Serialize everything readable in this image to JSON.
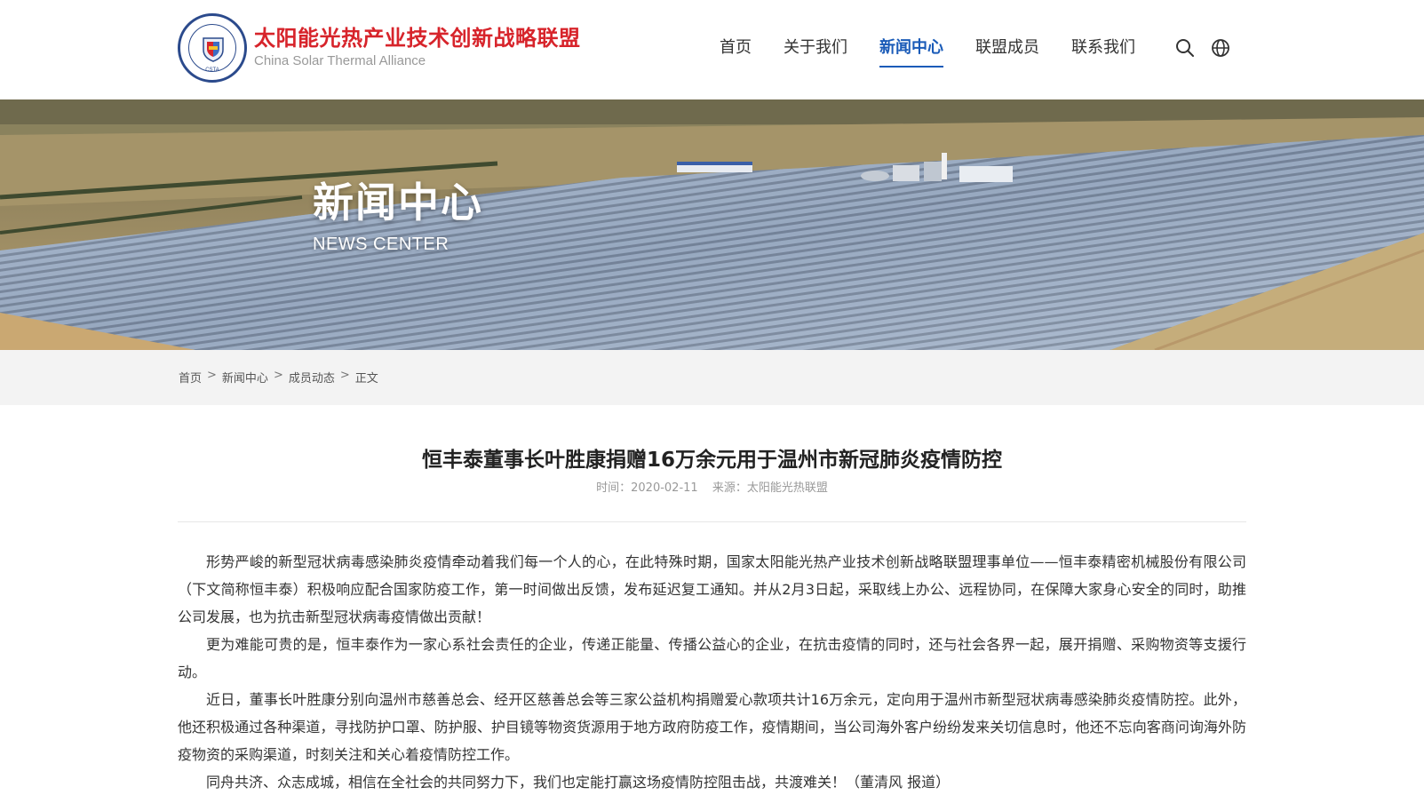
{
  "header": {
    "logo_cn": "太阳能光热产业技术创新战略联盟",
    "logo_en": "China Solar Thermal Alliance",
    "logo_badge": "CSTA",
    "nav": [
      {
        "label": "首页",
        "active": false
      },
      {
        "label": "关于我们",
        "active": false
      },
      {
        "label": "新闻中心",
        "active": true
      },
      {
        "label": "联盟成员",
        "active": false
      },
      {
        "label": "联系我们",
        "active": false
      }
    ],
    "icons": [
      "search-icon",
      "globe-icon"
    ]
  },
  "banner": {
    "title": "新闻中心",
    "subtitle": "NEWS CENTER"
  },
  "breadcrumb": {
    "items": [
      "首页",
      "新闻中心",
      "成员动态",
      "正文"
    ],
    "separator": ">"
  },
  "article": {
    "title": "恒丰泰董事长叶胜康捐赠16万余元用于温州市新冠肺炎疫情防控",
    "time_label": "时间：2020-02-11",
    "source_label": "来源：太阳能光热联盟",
    "paragraphs": [
      "形势严峻的新型冠状病毒感染肺炎疫情牵动着我们每一个人的心，在此特殊时期，国家太阳能光热产业技术创新战略联盟理事单位——恒丰泰精密机械股份有限公司（下文简称恒丰泰）积极响应配合国家防疫工作，第一时间做出反馈，发布延迟复工通知。并从2月3日起，采取线上办公、远程协同，在保障大家身心安全的同时，助推公司发展，也为抗击新型冠状病毒疫情做出贡献！",
      "更为难能可贵的是，恒丰泰作为一家心系社会责任的企业，传递正能量、传播公益心的企业，在抗击疫情的同时，还与社会各界一起，展开捐赠、采购物资等支援行动。",
      "近日，董事长叶胜康分别向温州市慈善总会、经开区慈善总会等三家公益机构捐赠爱心款项共计16万余元，定向用于温州市新型冠状病毒感染肺炎疫情防控。此外，他还积极通过各种渠道，寻找防护口罩、防护服、护目镜等物资货源用于地方政府防疫工作，疫情期间，当公司海外客户纷纷发来关切信息时，他还不忘向客商问询海外防疫物资的采购渠道，时刻关注和关心着疫情防控工作。",
      "同舟共济、众志成城，相信在全社会的共同努力下，我们也定能打赢这场疫情防控阻击战，共渡难关！（董清风 报道）"
    ]
  },
  "colors": {
    "brand_red": "#d7242b",
    "nav_active": "#1a5bb8",
    "logo_blue": "#2b4a8c"
  }
}
